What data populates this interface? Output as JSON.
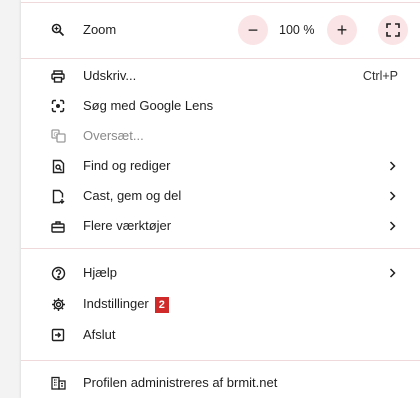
{
  "zoom": {
    "label": "Zoom",
    "minus": "−",
    "value": "100 %",
    "plus": "+"
  },
  "section1": [
    {
      "label": "Udskriv...",
      "shortcut": "Ctrl+P"
    },
    {
      "label": "Søg med Google Lens"
    },
    {
      "label": "Oversæt..."
    },
    {
      "label": "Find og rediger"
    },
    {
      "label": "Cast, gem og del"
    },
    {
      "label": "Flere værktøjer"
    }
  ],
  "section2": [
    {
      "label": "Hjælp"
    },
    {
      "label": "Indstillinger",
      "badge": "2"
    },
    {
      "label": "Afslut"
    }
  ],
  "footer": {
    "label": "Profilen administreres af brmit.net"
  },
  "colors": {
    "accent_bg": "#fbe4e6",
    "separator": "#f0d9db",
    "badge": "#d02a2a"
  }
}
